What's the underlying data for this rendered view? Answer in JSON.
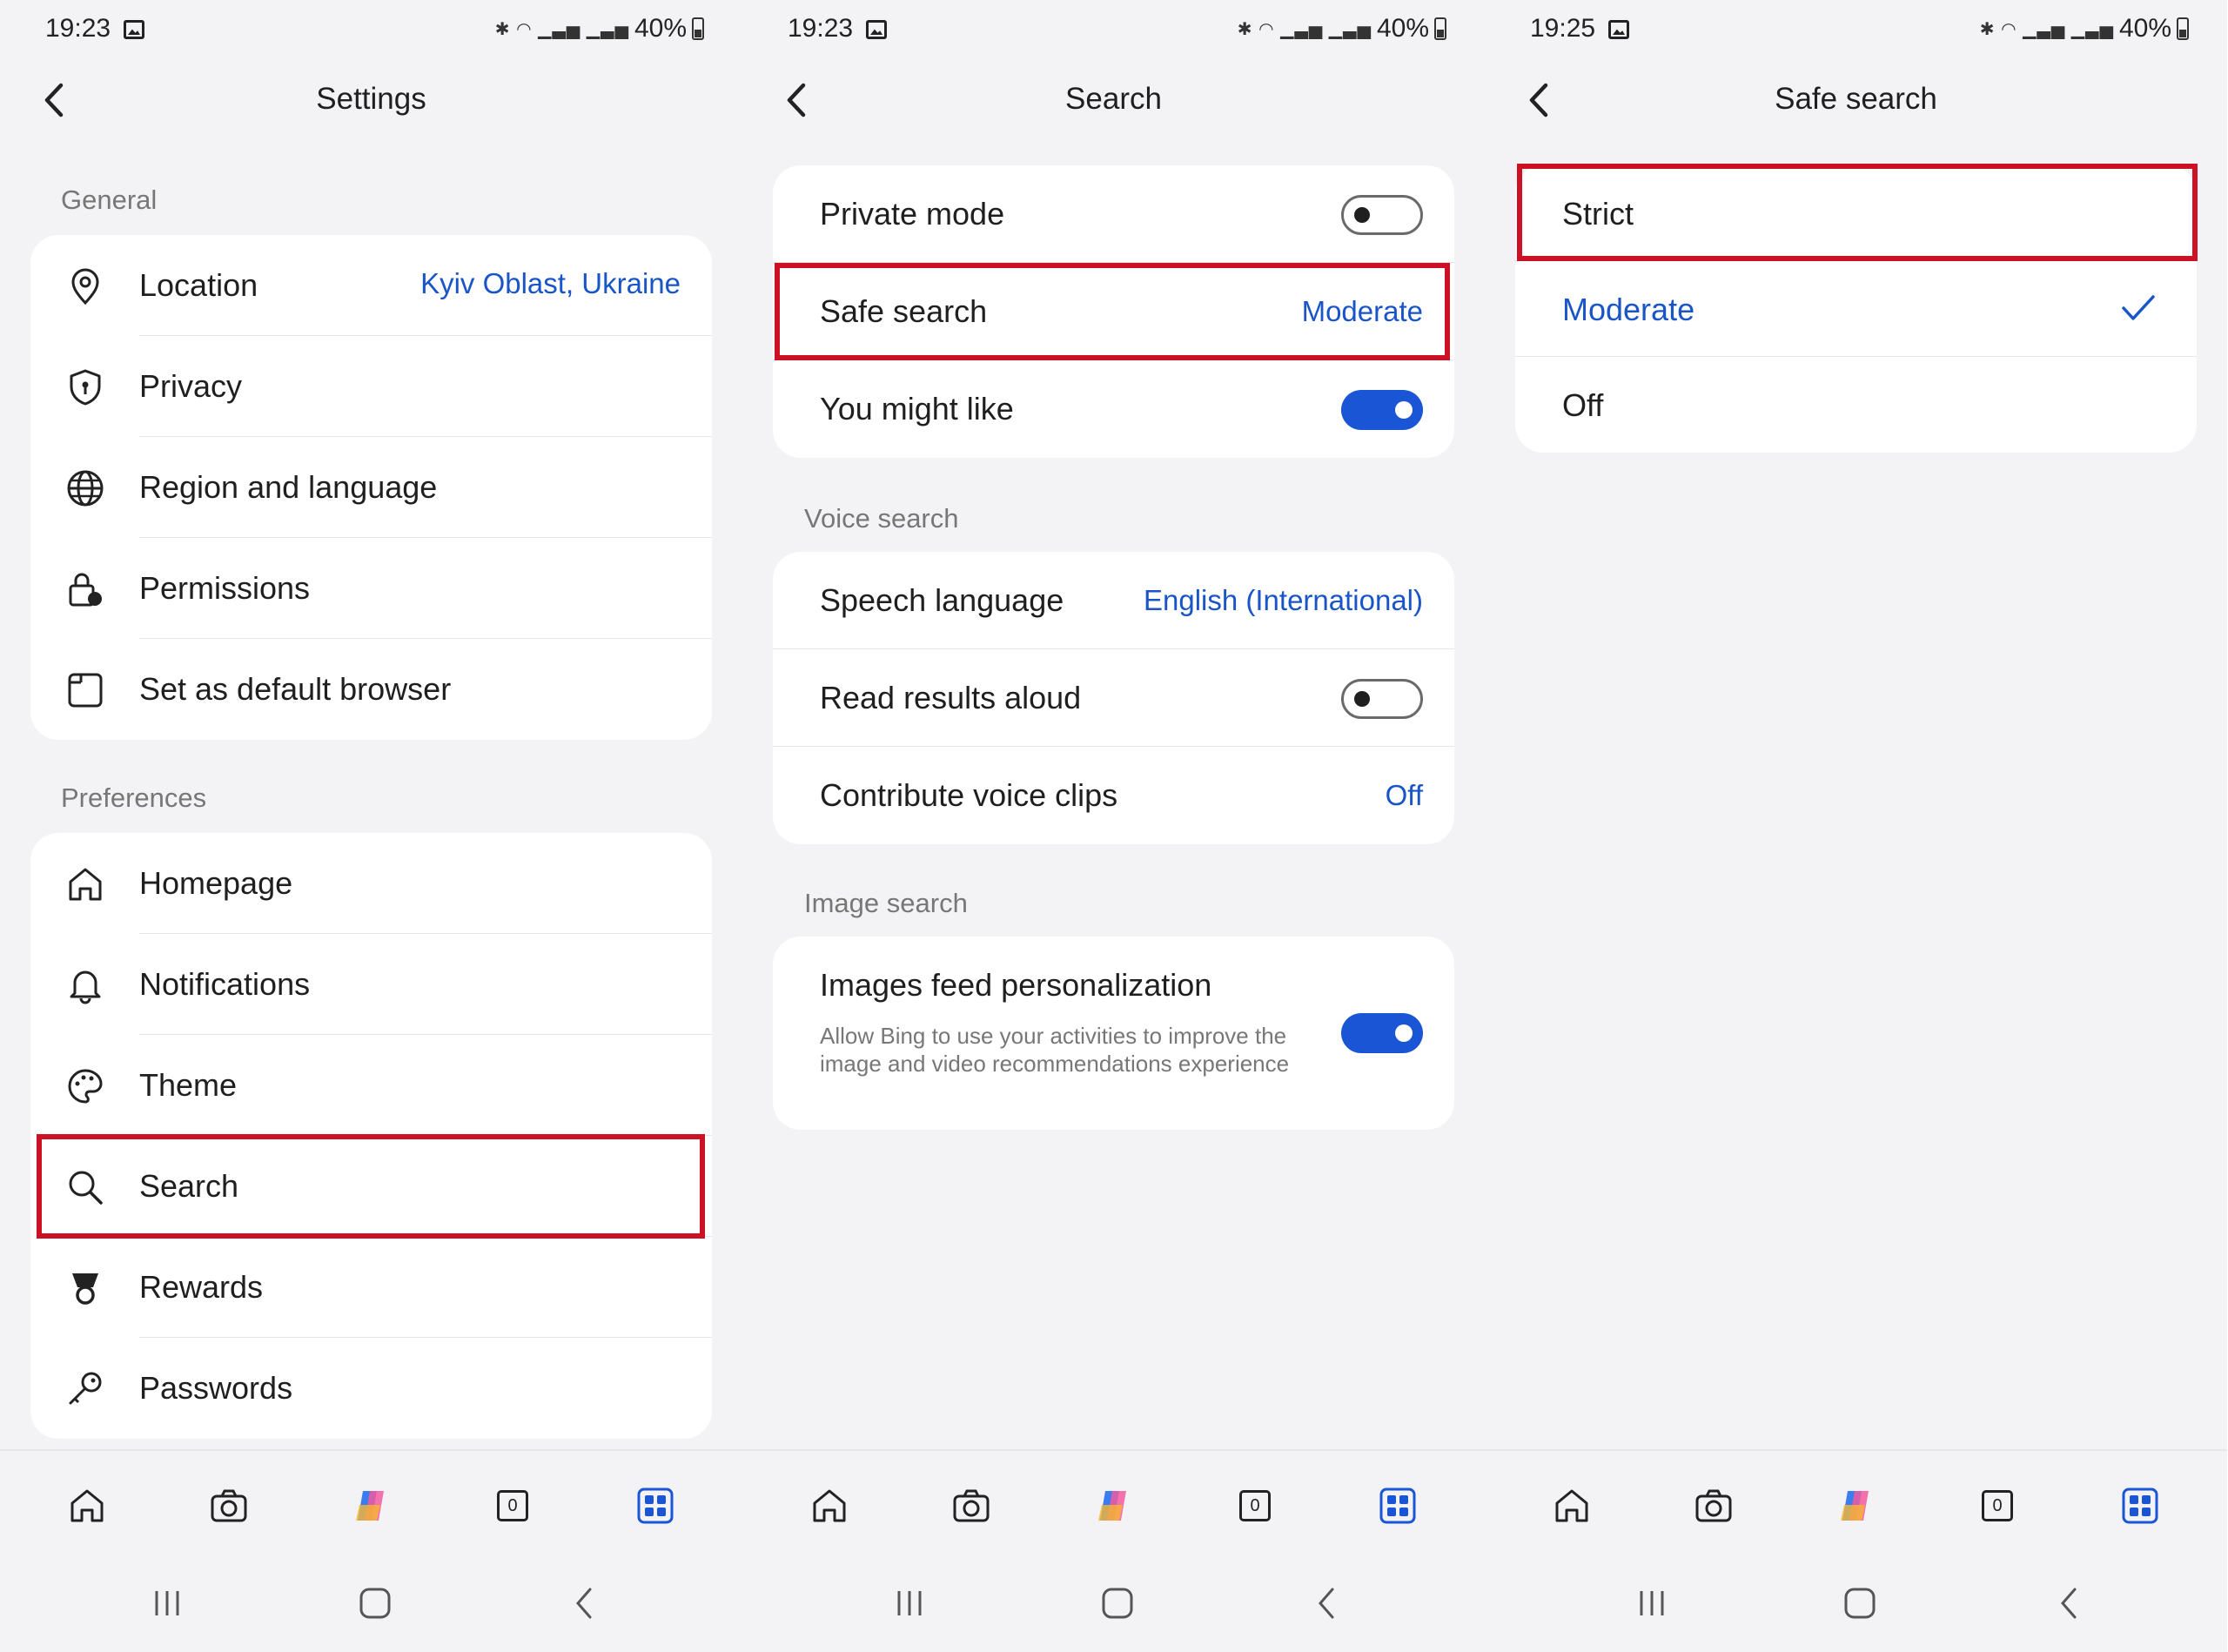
{
  "screens": [
    {
      "status": {
        "time": "19:23",
        "battery": "40%"
      },
      "header": {
        "title": "Settings"
      },
      "sections": [
        {
          "label": "General",
          "items": [
            {
              "icon": "location-pin-icon",
              "label": "Location",
              "value": "Kyiv Oblast, Ukraine"
            },
            {
              "icon": "shield-icon",
              "label": "Privacy"
            },
            {
              "icon": "globe-icon",
              "label": "Region and language"
            },
            {
              "icon": "lock-icon",
              "label": "Permissions"
            },
            {
              "icon": "browser-window-icon",
              "label": "Set as default browser"
            }
          ]
        },
        {
          "label": "Preferences",
          "items": [
            {
              "icon": "home-icon",
              "label": "Homepage"
            },
            {
              "icon": "bell-icon",
              "label": "Notifications"
            },
            {
              "icon": "palette-icon",
              "label": "Theme"
            },
            {
              "icon": "search-icon",
              "label": "Search"
            },
            {
              "icon": "trophy-icon",
              "label": "Rewards"
            },
            {
              "icon": "key-icon",
              "label": "Passwords"
            }
          ]
        }
      ]
    },
    {
      "status": {
        "time": "19:23",
        "battery": "40%"
      },
      "header": {
        "title": "Search"
      },
      "main": [
        {
          "label": "Private mode",
          "toggle": false
        },
        {
          "label": "Safe search",
          "value": "Moderate"
        },
        {
          "label": "You might like",
          "toggle": true
        }
      ],
      "voice": {
        "label": "Voice search",
        "items": [
          {
            "label": "Speech language",
            "value": "English (International)"
          },
          {
            "label": "Read results aloud",
            "toggle": false
          },
          {
            "label": "Contribute voice clips",
            "value": "Off"
          }
        ]
      },
      "image": {
        "label": "Image search",
        "item": {
          "label": "Images feed personalization",
          "desc": "Allow Bing to use your activities to improve the image and video recommendations experience",
          "toggle": true
        }
      }
    },
    {
      "status": {
        "time": "19:25",
        "battery": "40%"
      },
      "header": {
        "title": "Safe search"
      },
      "options": [
        {
          "label": "Strict",
          "selected": false
        },
        {
          "label": "Moderate",
          "selected": true
        },
        {
          "label": "Off",
          "selected": false
        }
      ]
    }
  ],
  "colors": {
    "accent": "#1a55c7",
    "highlight": "#cc1124",
    "background": "#f3f3f5"
  },
  "bottom_nav": [
    "home-icon",
    "camera-icon",
    "copilot-icon",
    "tabs-icon",
    "apps-icon"
  ],
  "tabs_count": "0"
}
